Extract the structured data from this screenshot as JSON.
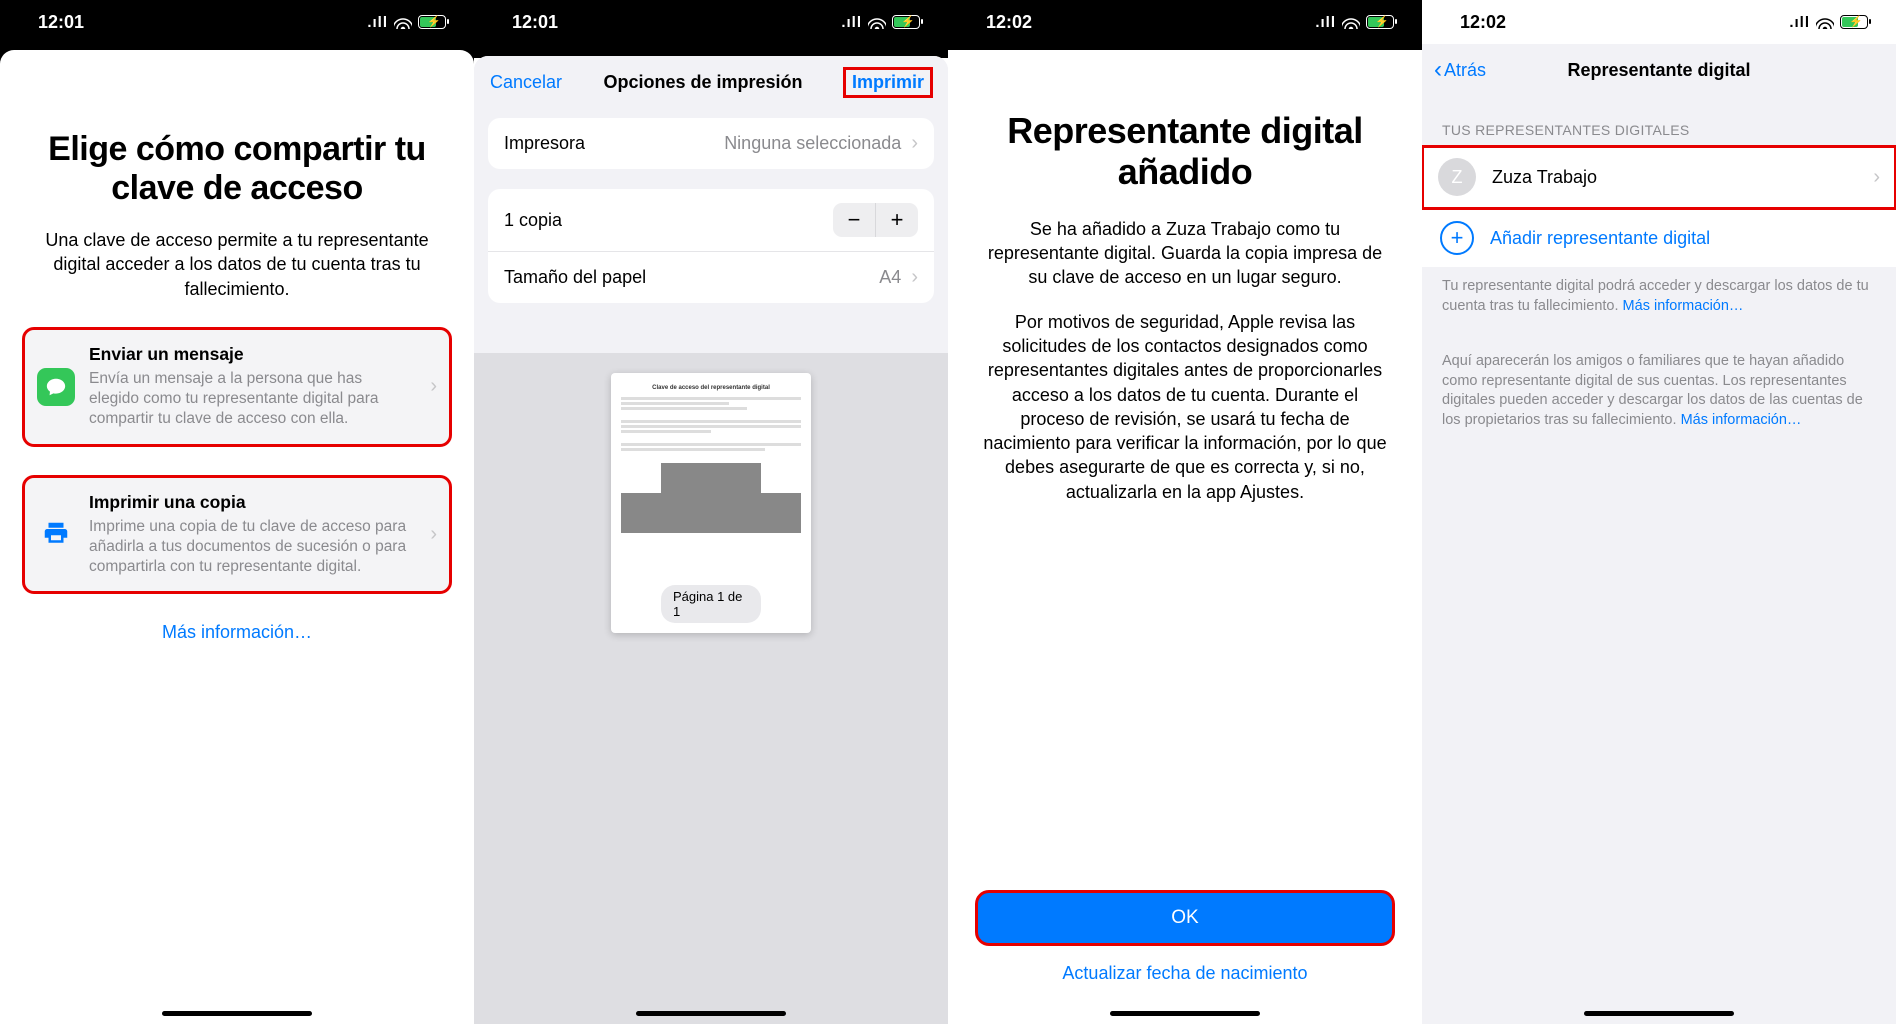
{
  "status": {
    "t1": "12:01",
    "t2": "12:01",
    "t3": "12:02",
    "t4": "12:02"
  },
  "s1": {
    "title": "Elige cómo compartir tu clave de acceso",
    "sub": "Una clave de acceso permite a tu representante digital acceder a los datos de tu cuenta tras tu fallecimiento.",
    "o1t": "Enviar un mensaje",
    "o1d": "Envía un mensaje a la persona que has elegido como tu representante digital para compartir tu clave de acceso con ella.",
    "o2t": "Imprimir una copia",
    "o2d": "Imprime una copia de tu clave de acceso para añadirla a tus documentos de sucesión o para compartirla con tu representante digital.",
    "more": "Más información…"
  },
  "s2": {
    "cancel": "Cancelar",
    "title": "Opciones de impresión",
    "print": "Imprimir",
    "printer_l": "Impresora",
    "printer_v": "Ninguna seleccionada",
    "copies": "1 copia",
    "paper_l": "Tamaño del papel",
    "paper_v": "A4",
    "page": "Página 1 de 1",
    "doc_title": "Clave de acceso del representante digital"
  },
  "s3": {
    "title": "Representante digital añadido",
    "p1": "Se ha añadido a Zuza Trabajo como tu representante digital. Guarda la copia impresa de su clave de acceso en un lugar seguro.",
    "p2": "Por motivos de seguridad, Apple revisa las solicitudes de los contactos designados como representantes digitales antes de proporcionarles acceso a los datos de tu cuenta. Durante el proceso de revisión, se usará tu fecha de nacimiento para verificar la información, por lo que debes asegurarte de que es correcta y, si no, actualizarla en la app Ajustes.",
    "ok": "OK",
    "update": "Actualizar fecha de nacimiento"
  },
  "s4": {
    "back": "Atrás",
    "title": "Representante digital",
    "header": "TUS REPRESENTANTES DIGITALES",
    "contact": "Zuza Trabajo",
    "initial": "Z",
    "add": "Añadir representante digital",
    "note1a": "Tu representante digital podrá acceder y descargar los datos de tu cuenta tras tu fallecimiento. ",
    "note1b": "Más información…",
    "note2a": "Aquí aparecerán los amigos o familiares que te hayan añadido como representante digital de sus cuentas. Los representantes digitales pueden acceder y descargar los datos de las cuentas de los propietarios tras su fallecimiento. ",
    "note2b": "Más información…"
  }
}
